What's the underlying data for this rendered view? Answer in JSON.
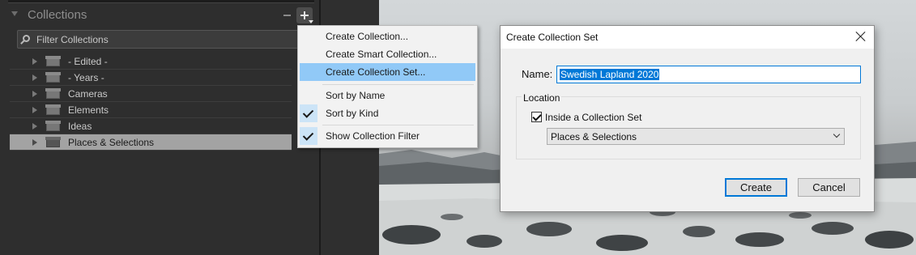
{
  "panel": {
    "title": "Collections",
    "filter_label": "Filter Collections",
    "items": [
      {
        "label": "- Edited -",
        "selected": false
      },
      {
        "label": "- Years -",
        "selected": false
      },
      {
        "label": "Cameras",
        "selected": false
      },
      {
        "label": "Elements",
        "selected": false
      },
      {
        "label": "Ideas",
        "selected": false
      },
      {
        "label": "Places & Selections",
        "selected": true
      }
    ]
  },
  "context_menu": {
    "items": [
      {
        "label": "Create Collection...",
        "checked": false,
        "highlighted": false
      },
      {
        "label": "Create Smart Collection...",
        "checked": false,
        "highlighted": false
      },
      {
        "label": "Create Collection Set...",
        "checked": false,
        "highlighted": true
      },
      {
        "label": "Sort by Name",
        "checked": false,
        "highlighted": false
      },
      {
        "label": "Sort by Kind",
        "checked": true,
        "highlighted": false
      },
      {
        "label": "Show Collection Filter",
        "checked": true,
        "highlighted": false
      }
    ]
  },
  "dialog": {
    "title": "Create Collection Set",
    "name_label": "Name:",
    "name_value": "Swedish Lapland 2020",
    "location_label": "Location",
    "inside_set_label": "Inside a Collection Set",
    "inside_set_checked": true,
    "parent_set_value": "Places & Selections",
    "create_label": "Create",
    "cancel_label": "Cancel"
  },
  "colors": {
    "accent": "#0078d7",
    "menu_highlight": "#91c9f7",
    "panel_bg": "#2e2e2e"
  }
}
